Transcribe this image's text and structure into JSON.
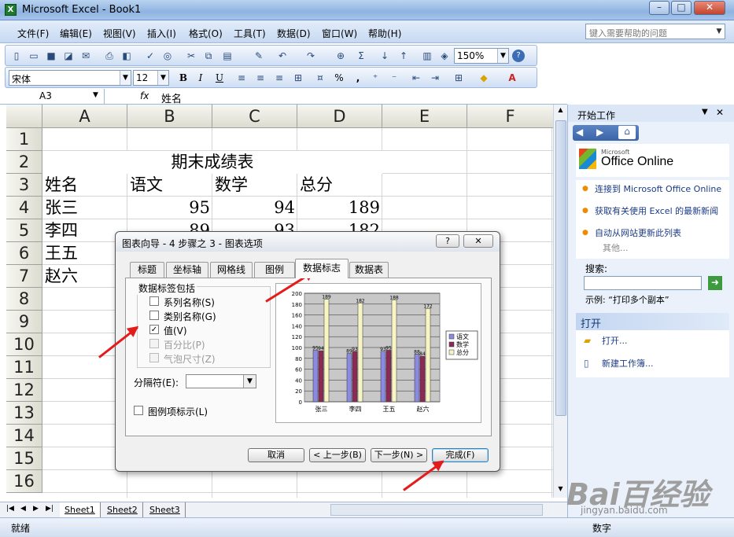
{
  "window": {
    "title": "Microsoft Excel - Book1",
    "icon": "excel-icon"
  },
  "menu": [
    "文件(F)",
    "编辑(E)",
    "视图(V)",
    "插入(I)",
    "格式(O)",
    "工具(T)",
    "数据(D)",
    "窗口(W)",
    "帮助(H)"
  ],
  "help_placeholder": "键入需要帮助的问题",
  "toolbar": {
    "zoom": "150%",
    "font_name": "宋体",
    "font_size": "12",
    "bold": "B",
    "italic": "I",
    "underline": "U",
    "percent": "%",
    "comma": ","
  },
  "formula_bar": {
    "name_box": "A3",
    "fx": "fx",
    "content": "姓名"
  },
  "sheet": {
    "columns": [
      "A",
      "B",
      "C",
      "D",
      "E",
      "F"
    ],
    "rows": [
      "1",
      "2",
      "3",
      "4",
      "5",
      "6",
      "7",
      "8",
      "9",
      "10",
      "11",
      "12",
      "13",
      "14",
      "15",
      "16"
    ],
    "title": "期末成绩表",
    "headers": [
      "姓名",
      "语文",
      "数学",
      "总分"
    ],
    "data": [
      {
        "name": "张三",
        "chinese": "95",
        "math": "94",
        "total": "189"
      },
      {
        "name": "李四",
        "chinese": "89",
        "math": "93",
        "total": "182"
      },
      {
        "name": "王五",
        "chinese": "",
        "math": "",
        "total": ""
      },
      {
        "name": "赵六",
        "chinese": "",
        "math": "",
        "total": ""
      }
    ]
  },
  "sheet_tabs": [
    "Sheet1",
    "Sheet2",
    "Sheet3"
  ],
  "status": {
    "left": "就绪",
    "right": "数字"
  },
  "task_pane": {
    "title": "开始工作",
    "office_small": "Microsoft",
    "office_online": "Office Online",
    "links": [
      "连接到 Microsoft Office Online",
      "获取有关使用 Excel 的最新新闻",
      "自动从网站更新此列表"
    ],
    "more": "其他...",
    "search_label": "搜索:",
    "example": "示例: “打印多个副本”",
    "open_header": "打开",
    "open_link": "打开...",
    "new_link": "新建工作簿..."
  },
  "dialog": {
    "title": "图表向导 - 4 步骤之 3 - 图表选项",
    "help_btn": "?",
    "close_btn": "✕",
    "tabs": [
      "标题",
      "坐标轴",
      "网格线",
      "图例",
      "数据标志",
      "数据表"
    ],
    "active_tab": "数据标志",
    "group_label": "数据标签包括",
    "checkboxes": [
      {
        "label": "系列名称(S)",
        "checked": false,
        "enabled": true
      },
      {
        "label": "类别名称(G)",
        "checked": false,
        "enabled": true
      },
      {
        "label": "值(V)",
        "checked": true,
        "enabled": true
      },
      {
        "label": "百分比(P)",
        "checked": false,
        "enabled": false
      },
      {
        "label": "气泡尺寸(Z)",
        "checked": false,
        "enabled": false
      }
    ],
    "separator_label": "分隔符(E):",
    "legend_key_label": "图例项标示(L)",
    "buttons": {
      "cancel": "取消",
      "back": "< 上一步(B)",
      "next": "下一步(N) >",
      "finish": "完成(F)"
    }
  },
  "chart_data": {
    "type": "bar",
    "categories": [
      "张三",
      "李四",
      "王五",
      "赵六"
    ],
    "series": [
      {
        "name": "语文",
        "values": [
          95,
          89,
          93,
          88
        ],
        "color": "#8a8ae0"
      },
      {
        "name": "数学",
        "values": [
          94,
          93,
          95,
          84
        ],
        "color": "#8b2a55"
      },
      {
        "name": "总分",
        "values": [
          189,
          182,
          188,
          172
        ],
        "color": "#f7f5c4"
      }
    ],
    "yticks": [
      "0",
      "20",
      "40",
      "60",
      "80",
      "100",
      "120",
      "140",
      "160",
      "180",
      "200"
    ],
    "ylim": [
      0,
      200
    ],
    "data_labels": [
      "95",
      "94",
      "189",
      "89",
      "93",
      "182",
      "93",
      "95",
      "188",
      "88",
      "84",
      "172"
    ],
    "legend_position": "right"
  },
  "watermark": {
    "brand": "Bai百经验",
    "url": "jingyan.baidu.com"
  }
}
